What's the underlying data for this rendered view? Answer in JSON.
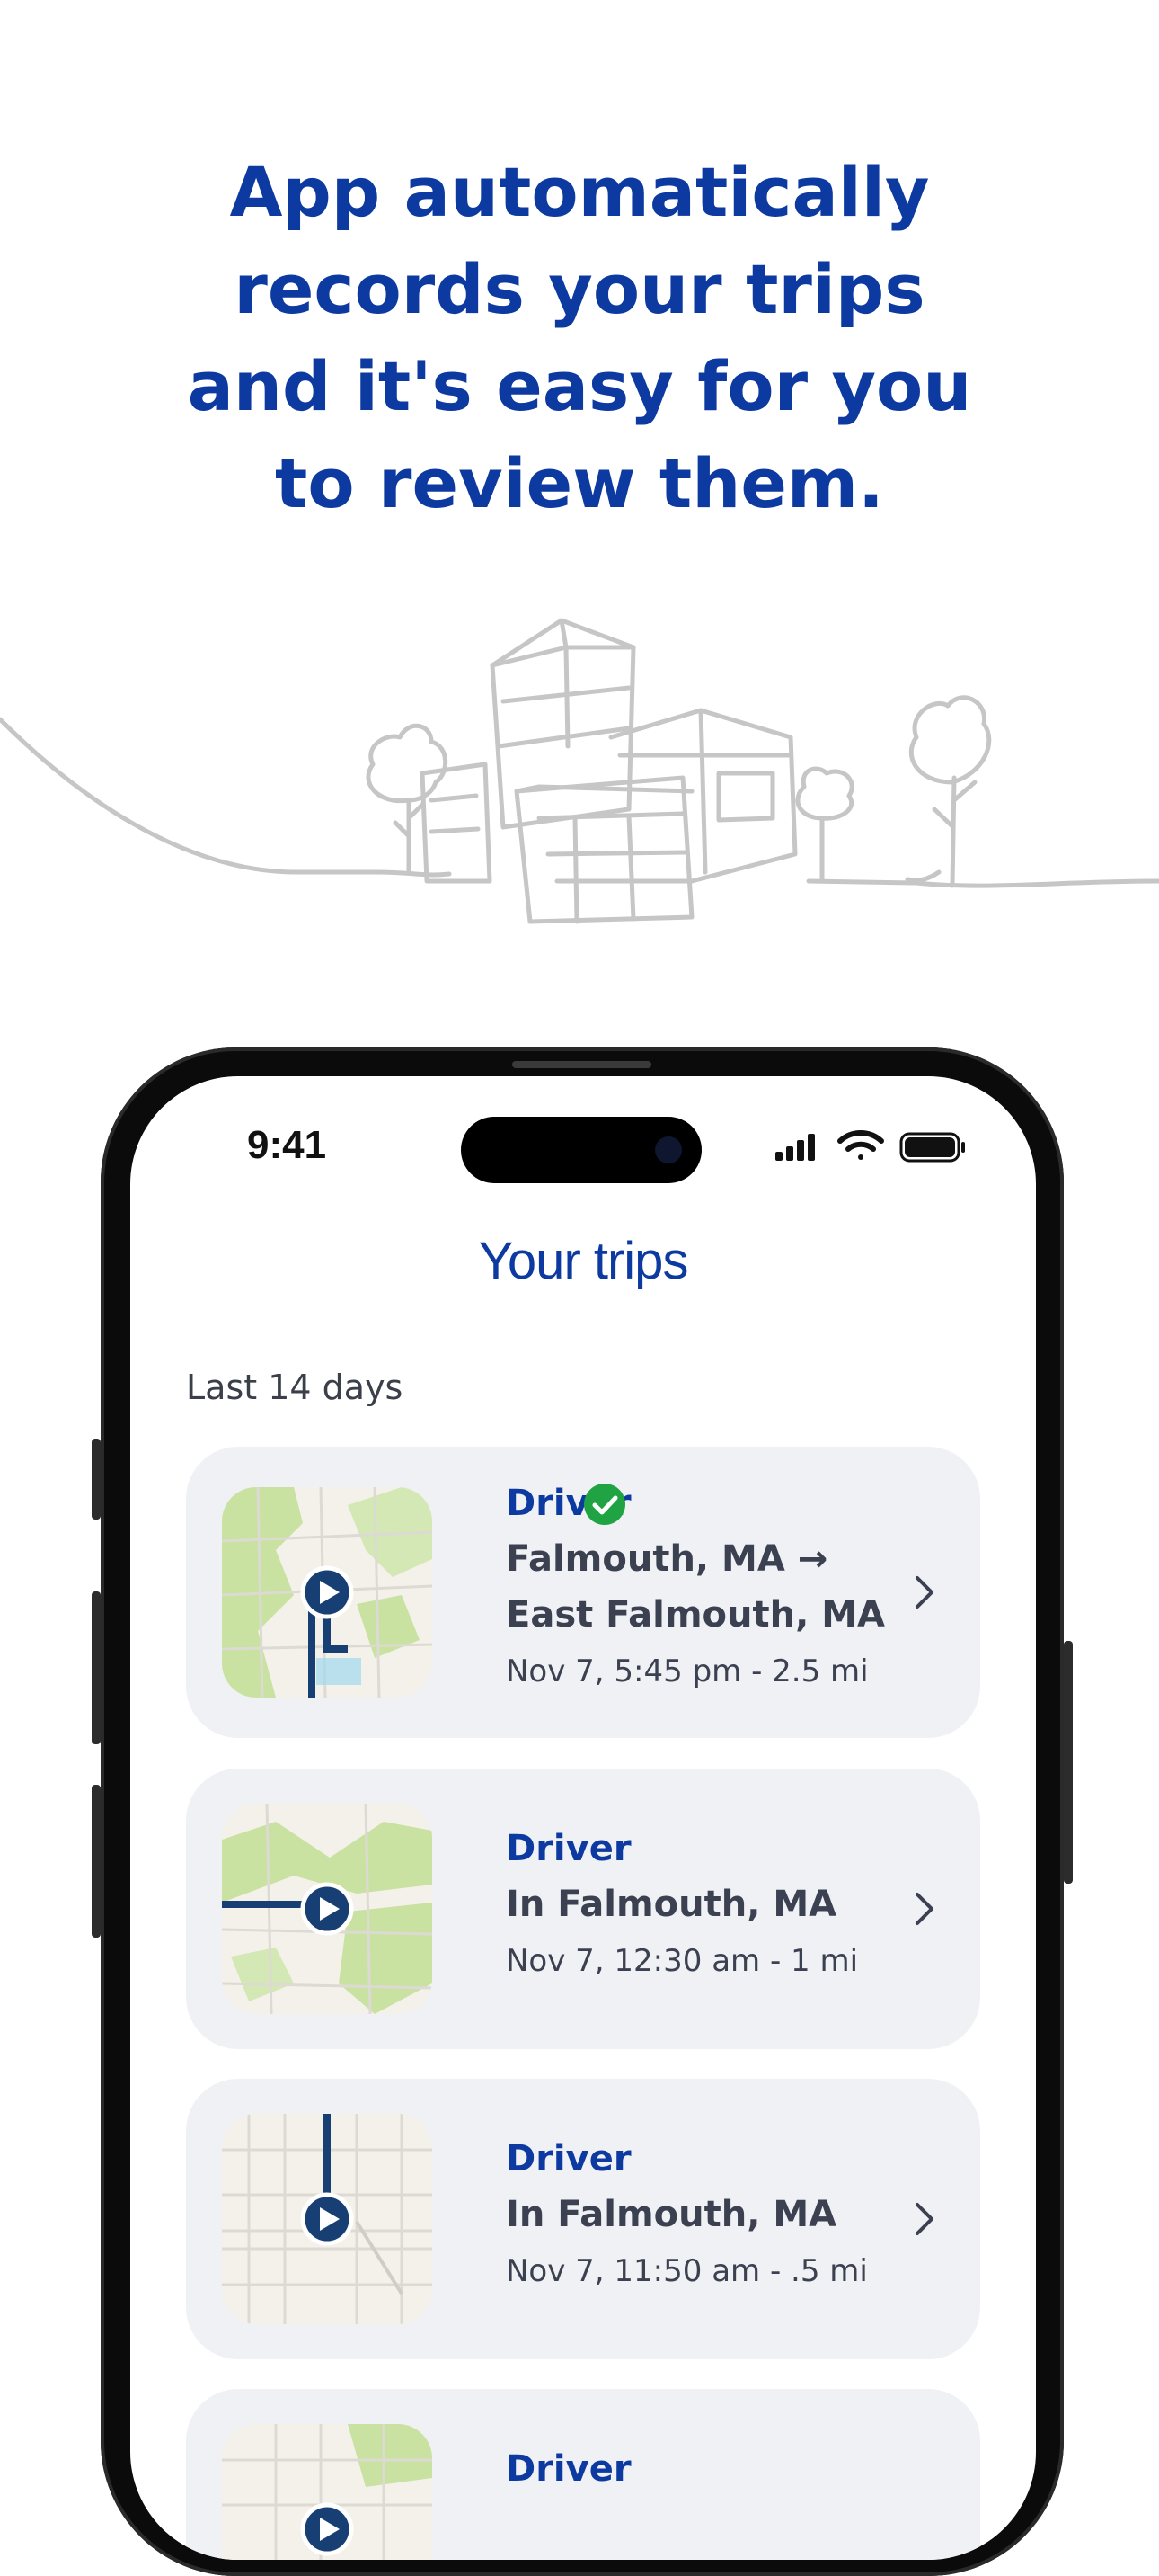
{
  "headline": {
    "line1": "App automatically",
    "line2": "records your trips",
    "line3": "and it's easy for you",
    "line4": "to review them."
  },
  "status_bar": {
    "time": "9:41"
  },
  "screen": {
    "title": "Your trips",
    "section": "Last 14 days"
  },
  "trips": [
    {
      "role": "Driver",
      "verified": true,
      "route_from": "Falmouth, MA",
      "arrow": "→",
      "route_to": "East Falmouth, MA",
      "meta": "Nov 7, 5:45 pm - 2.5 mi"
    },
    {
      "role": "Driver",
      "route": "In Falmouth, MA",
      "meta": "Nov 7, 12:30 am - 1 mi"
    },
    {
      "role": "Driver",
      "route": "In Falmouth, MA",
      "meta": "Nov 7, 11:50 am - .5 mi"
    },
    {
      "role": "Driver"
    }
  ],
  "colors": {
    "brand": "#0d3aa0",
    "card": "#eff1f5",
    "text": "#3b4150",
    "check": "#1fa343",
    "route": "#173f73",
    "map_land": "#f3f1ea",
    "map_green": "#c9e2a2"
  }
}
